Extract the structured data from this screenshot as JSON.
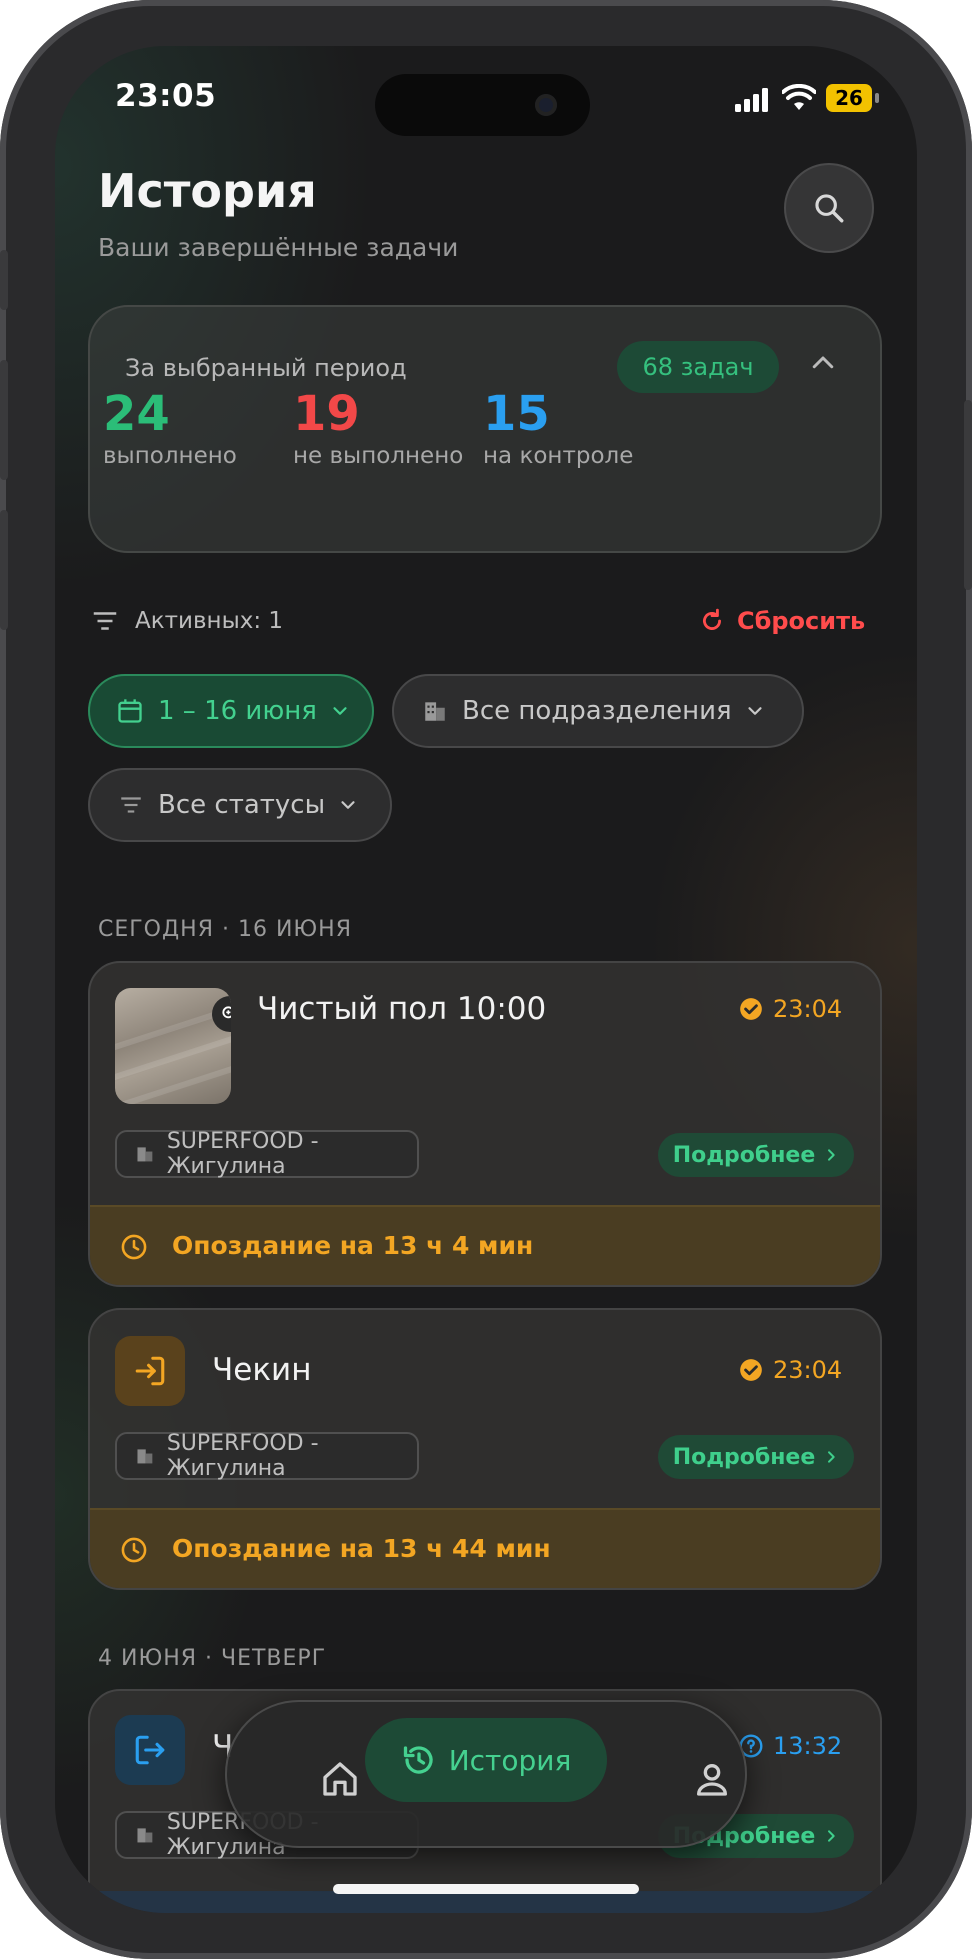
{
  "status_bar": {
    "time": "23:05",
    "battery": "26"
  },
  "header": {
    "title": "История",
    "subtitle": "Ваши завершённые задачи"
  },
  "summary": {
    "label": "За выбранный период",
    "total_badge": "68 задач",
    "stats": [
      {
        "value": "24",
        "label": "выполнено",
        "color": "#2bbd78"
      },
      {
        "value": "19",
        "label": "не выполнено",
        "color": "#f24848"
      },
      {
        "value": "15",
        "label": "на контроле",
        "color": "#2a9ff0"
      }
    ]
  },
  "filters": {
    "active_label": "Активных: 1",
    "reset_label": "Сбросить",
    "date_chip": "1 – 16 июня",
    "dept_chip": "Все подразделения",
    "status_chip": "Все статусы"
  },
  "sections": [
    {
      "heading": "СЕГОДНЯ · 16 ИЮНЯ",
      "items": [
        {
          "title": "Чистый пол 10:00",
          "time": "23:04",
          "department": "SUPERFOOD - Жигулина",
          "more": "Подробнее",
          "late": "Опоздание на 13 ч 4 мин",
          "icon": "photo-thumbnail"
        },
        {
          "title": "Чекин",
          "time": "23:04",
          "department": "SUPERFOOD - Жигулина",
          "more": "Подробнее",
          "late": "Опоздание на 13 ч 44 мин",
          "icon": "login-icon"
        }
      ]
    },
    {
      "heading": "4 ИЮНЯ · ЧЕТВЕРГ",
      "items": [
        {
          "title": "Ч",
          "time": "13:32",
          "department": "SUPERFOOD - Жигулина",
          "more": "Подробнее",
          "icon": "logout-icon"
        }
      ]
    }
  ],
  "nav": {
    "active_label": "История",
    "items": [
      "home-icon",
      "history-icon",
      "profile-icon"
    ]
  },
  "colors": {
    "accent_green": "#45d190",
    "late_orange": "#f3a623",
    "reset_red": "#ff4c4c",
    "info_blue": "#2a9ff0"
  }
}
